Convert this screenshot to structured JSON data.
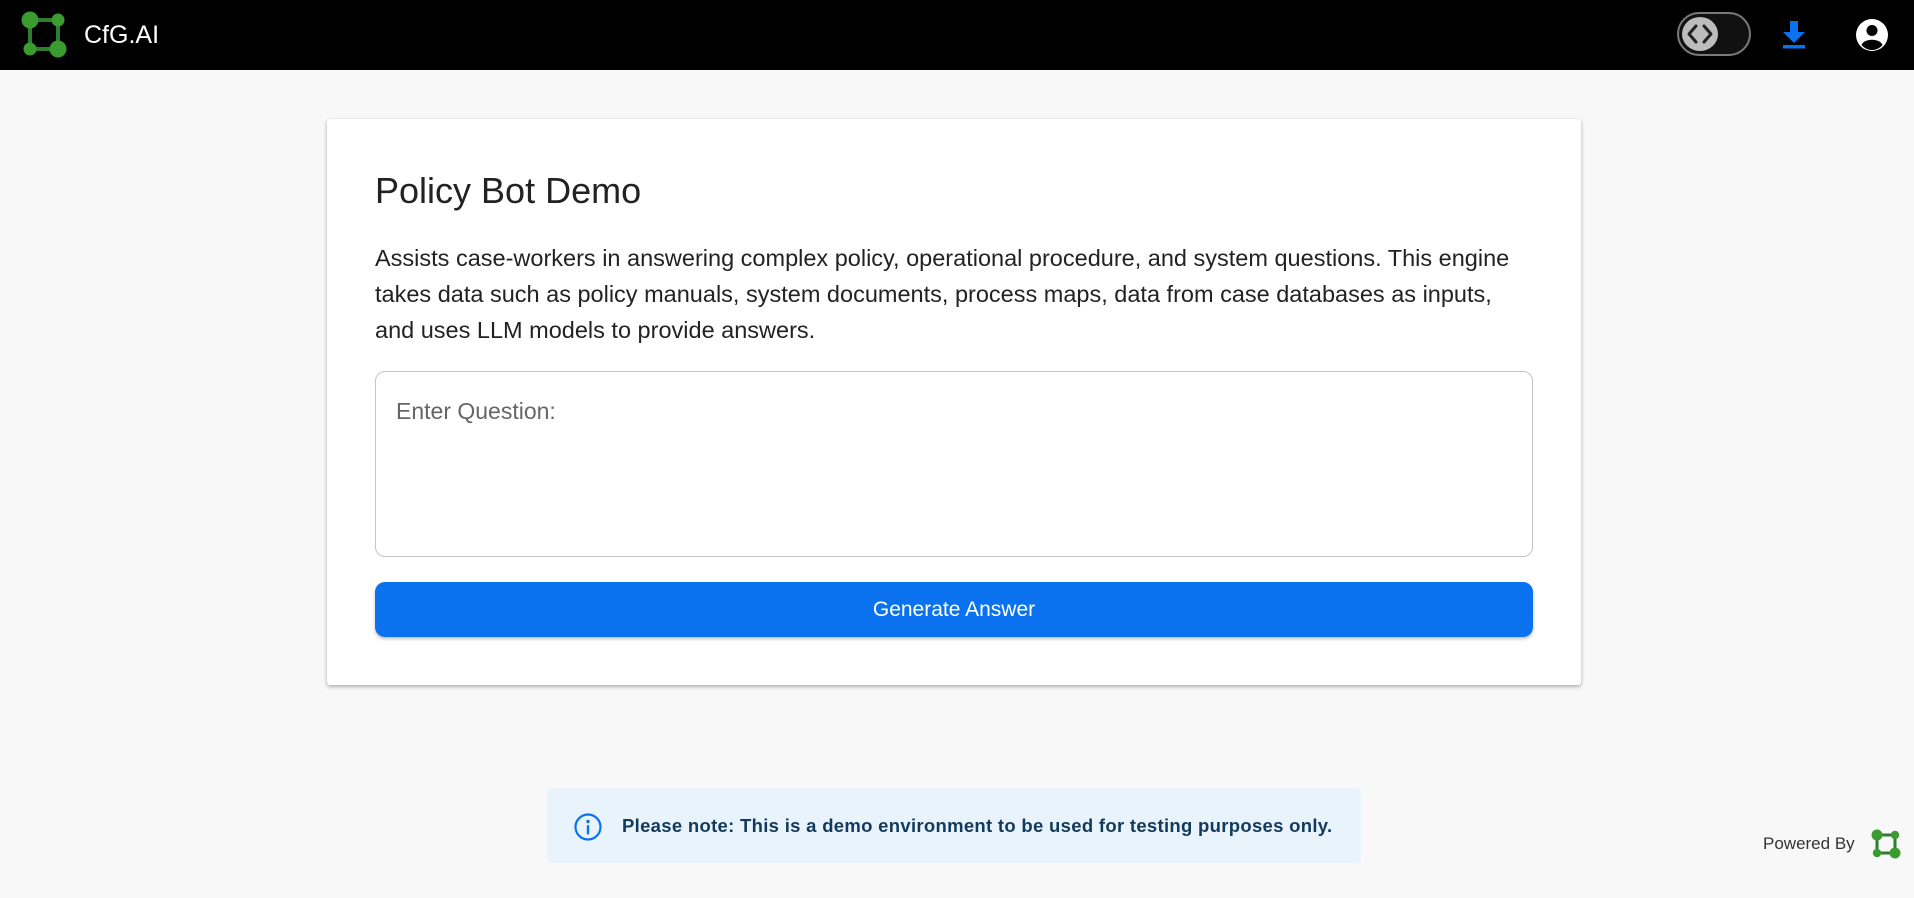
{
  "header": {
    "app_title": "CfG.AI",
    "logo_icon": "network-nodes-icon",
    "toggle_icon": "code-brackets-icon",
    "download_icon": "download-icon",
    "account_icon": "account-circle-icon"
  },
  "card": {
    "title": "Policy Bot Demo",
    "description": "Assists case-workers in answering complex policy, operational procedure, and system questions. This engine takes data such as policy manuals, system documents, process maps, data from case databases as inputs, and uses LLM models to provide answers.",
    "question_placeholder": "Enter Question:",
    "question_value": "",
    "generate_label": "Generate Answer"
  },
  "notice": {
    "icon": "info-icon",
    "text": "Please note: This is a demo environment to be used for testing purposes only."
  },
  "footer": {
    "powered_by": "Powered By"
  },
  "colors": {
    "primary": "#0a72ee",
    "logo_green_dark": "#2e7d32",
    "logo_green_light": "#4caf50",
    "header_bg": "#000000",
    "notice_bg": "#e9f3fc"
  }
}
